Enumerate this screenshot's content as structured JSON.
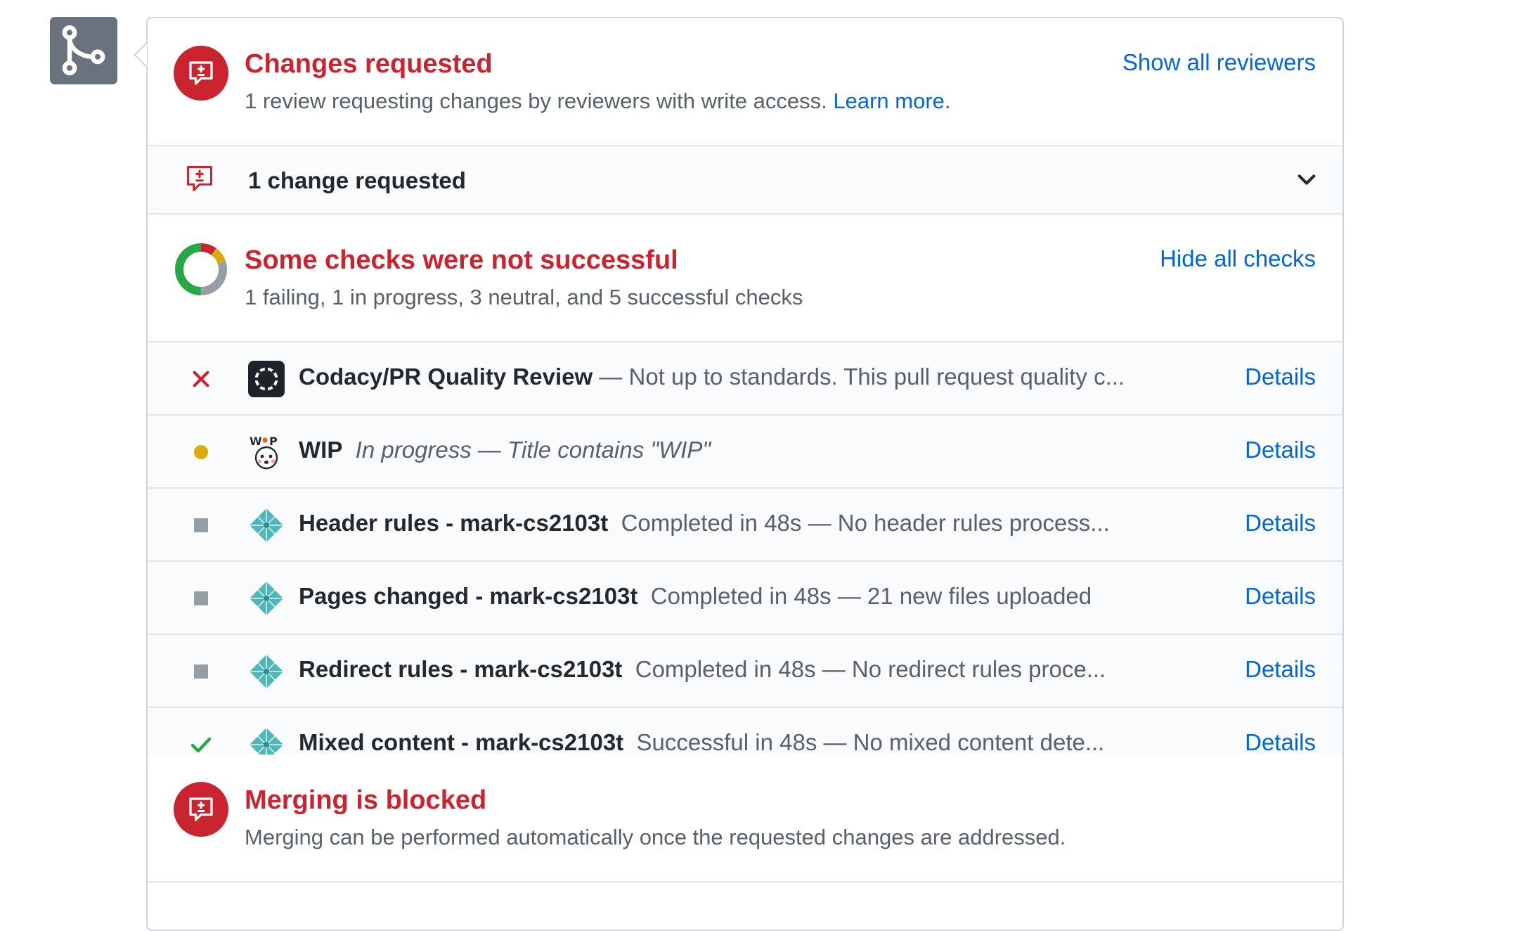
{
  "review": {
    "title": "Changes requested",
    "subtitle": "1 review requesting changes by reviewers with write access.",
    "learn_more": "Learn more.",
    "show_reviewers": "Show all reviewers"
  },
  "change_summary": {
    "label": "1 change requested"
  },
  "checks": {
    "title": "Some checks were not successful",
    "subtitle": "1 failing, 1 in progress, 3 neutral, and 5 successful checks",
    "hide_link": "Hide all checks",
    "status_breakdown": {
      "failing": 1,
      "in_progress": 1,
      "neutral": 3,
      "successful": 5
    },
    "items": [
      {
        "status": "failed",
        "icon": "codacy-icon",
        "name": "Codacy/PR Quality Review",
        "sep": " — ",
        "description": "Not up to standards. This pull request quality c...",
        "italic": false,
        "details": "Details"
      },
      {
        "status": "in-progress",
        "icon": "wip-icon",
        "name": "WIP",
        "sep": "",
        "description": "In progress — Title contains \"WIP\"",
        "italic": true,
        "details": "Details"
      },
      {
        "status": "neutral",
        "icon": "netlify-icon",
        "name": "Header rules - mark-cs2103t",
        "sep": "",
        "description": "Completed in 48s — No header rules process...",
        "italic": false,
        "details": "Details"
      },
      {
        "status": "neutral",
        "icon": "netlify-icon",
        "name": "Pages changed - mark-cs2103t",
        "sep": "",
        "description": "Completed in 48s — 21 new files uploaded",
        "italic": false,
        "details": "Details"
      },
      {
        "status": "neutral",
        "icon": "netlify-icon",
        "name": "Redirect rules - mark-cs2103t",
        "sep": "",
        "description": "Completed in 48s — No redirect rules proce...",
        "italic": false,
        "details": "Details"
      },
      {
        "status": "success",
        "icon": "netlify-icon",
        "name": "Mixed content - mark-cs2103t",
        "sep": "",
        "description": "Successful in 48s — No mixed content dete...",
        "italic": false,
        "details": "Details"
      }
    ]
  },
  "merge": {
    "title": "Merging is blocked",
    "subtitle": "Merging can be performed automatically once the requested changes are addressed."
  },
  "colors": {
    "danger": "#cb2431",
    "link": "#0366d6",
    "success": "#28a745",
    "pending": "#dbab09",
    "neutral": "#959da5"
  }
}
